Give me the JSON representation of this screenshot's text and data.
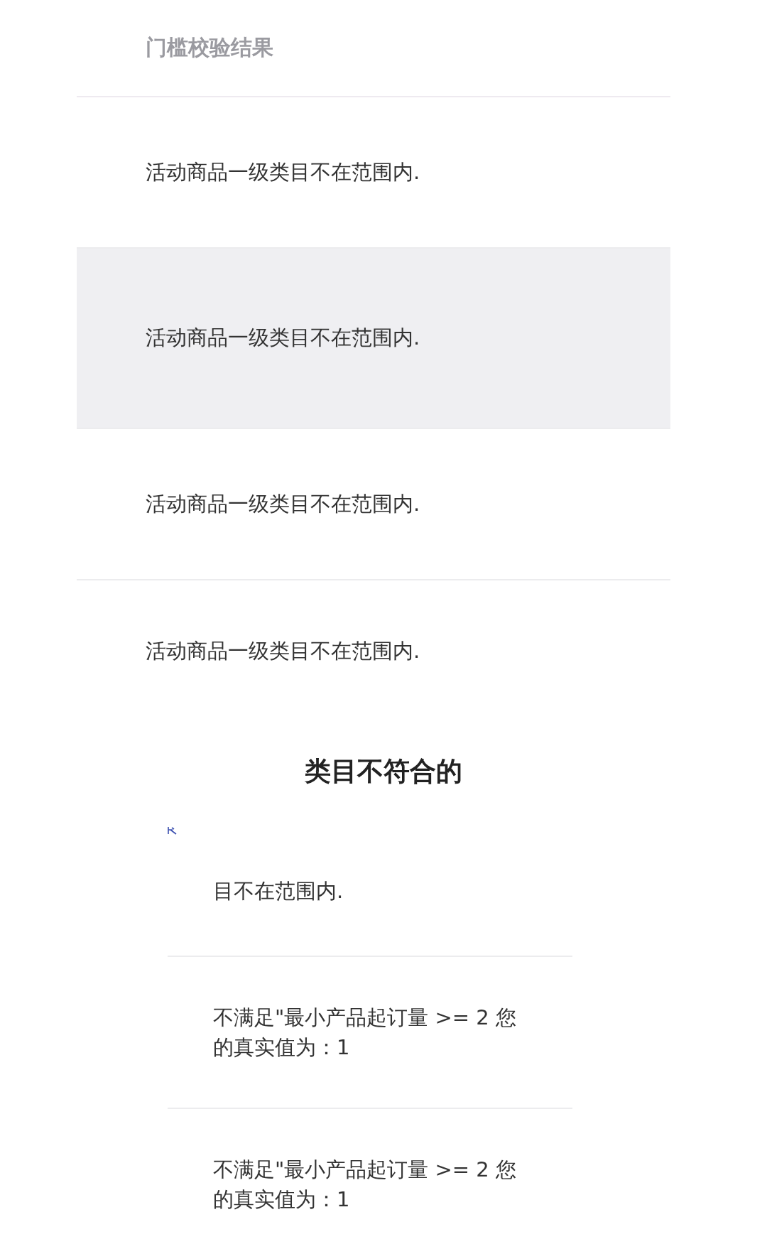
{
  "result_table": {
    "header": "门槛校验结果",
    "rows": [
      {
        "text": "活动商品一级类目不在范围内.",
        "selected": false
      },
      {
        "text": "活动商品一级类目不在范围内.",
        "selected": true
      },
      {
        "text": "活动商品一级类目不在范围内.",
        "selected": false
      },
      {
        "text": "活动商品一级类目不在范围内.",
        "selected": false
      }
    ]
  },
  "caption": "类目不符合的",
  "detail_table": {
    "rows": [
      {
        "text": "目不在范围内."
      },
      {
        "text": "不满足\"最小产品起订量 >= 2 您的真实值为：1"
      },
      {
        "text": "不满足\"最小产品起订量 >= 2 您的真实值为：1"
      }
    ]
  }
}
